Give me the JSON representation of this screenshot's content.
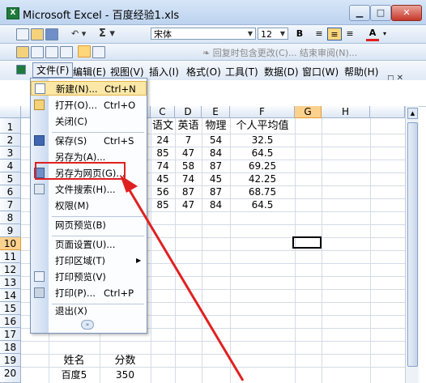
{
  "window": {
    "title": "Microsoft Excel - 百度经验1.xls",
    "app_icon": "excel-icon"
  },
  "toolbar": {
    "font_name": "宋体",
    "font_size": "12",
    "bold_label": "B",
    "sigma_label": "Σ",
    "review_text": "❧ 回复时包含更改(C)... 结束审阅(N)..."
  },
  "menubar": {
    "items": [
      "文件(F)",
      "编辑(E)",
      "视图(V)",
      "插入(I)",
      "格式(O)",
      "工具(T)",
      "数据(D)",
      "窗口(W)",
      "帮助(H)"
    ]
  },
  "columns": [
    "C",
    "D",
    "E",
    "F",
    "G",
    "H"
  ],
  "rows": [
    "1",
    "2",
    "3",
    "4",
    "5",
    "6",
    "7",
    "8",
    "9",
    "10",
    "11",
    "12",
    "13",
    "14",
    "15",
    "16",
    "17",
    "18",
    "19",
    "20"
  ],
  "table": {
    "headers": [
      "语文",
      "英语",
      "物理",
      "个人平均值"
    ],
    "rows": [
      [
        "24",
        "7",
        "54",
        "32.5"
      ],
      [
        "85",
        "47",
        "84",
        "64.5"
      ],
      [
        "74",
        "58",
        "87",
        "69.25"
      ],
      [
        "45",
        "74",
        "45",
        "42.25"
      ],
      [
        "56",
        "87",
        "87",
        "68.75"
      ],
      [
        "85",
        "47",
        "84",
        "64.5"
      ]
    ]
  },
  "lower": {
    "r19": [
      "姓名",
      "分数"
    ],
    "r20": [
      "百度5",
      "350"
    ]
  },
  "file_menu": {
    "items": [
      {
        "label": "新建(N)...",
        "shortcut": "Ctrl+N",
        "icon": "new-document-icon"
      },
      {
        "label": "打开(O)...",
        "shortcut": "Ctrl+O",
        "icon": "open-folder-icon"
      },
      {
        "label": "关闭(C)",
        "shortcut": "",
        "icon": ""
      },
      {
        "label": "保存(S)",
        "shortcut": "Ctrl+S",
        "icon": "save-icon"
      },
      {
        "label": "另存为(A)...",
        "shortcut": "",
        "icon": ""
      },
      {
        "label": "另存为网页(G)...",
        "shortcut": "",
        "icon": "save-as-web-icon"
      },
      {
        "label": "文件搜索(H)...",
        "shortcut": "",
        "icon": "file-search-icon"
      },
      {
        "label": "权限(M)",
        "shortcut": "",
        "icon": ""
      },
      {
        "label": "网页预览(B)",
        "shortcut": "",
        "icon": ""
      },
      {
        "label": "页面设置(U)...",
        "shortcut": "",
        "icon": ""
      },
      {
        "label": "打印区域(T)",
        "shortcut": "",
        "icon": ""
      },
      {
        "label": "打印预览(V)",
        "shortcut": "",
        "icon": "print-preview-icon"
      },
      {
        "label": "打印(P)...",
        "shortcut": "Ctrl+P",
        "icon": "print-icon"
      },
      {
        "label": "退出(X)",
        "shortcut": "",
        "icon": ""
      }
    ]
  },
  "colors": {
    "accent": "#e02020",
    "menu_highlight": "#fbe7a6",
    "selected_header": "#fbd18e"
  }
}
